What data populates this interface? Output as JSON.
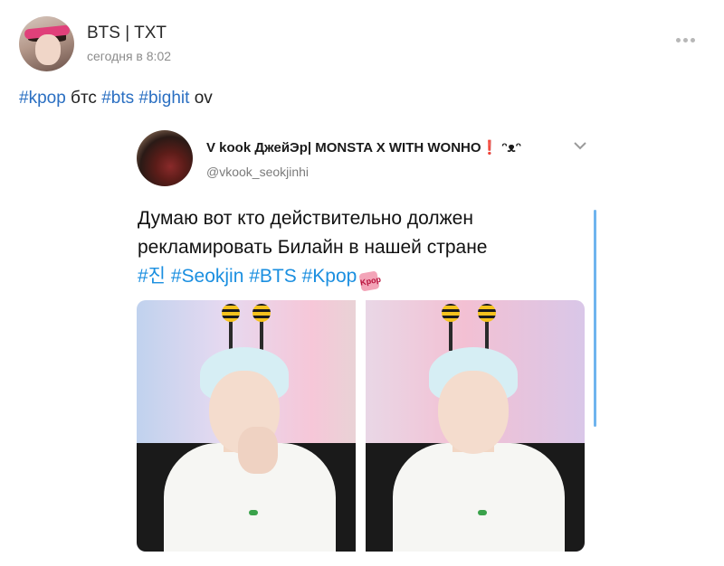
{
  "post": {
    "author": "BTS | TXT",
    "time": "сегодня в 8:02",
    "text_parts": [
      "#kpop",
      " бтс ",
      "#bts",
      " ",
      "#bighit",
      " ov"
    ]
  },
  "tweet": {
    "name": "V kook ДжейЭр| MONSTA X WITH WONHO❗ ᵔᴥᵔ",
    "handle": "@vkook_seokjinhi",
    "body_line1": "Думаю вот кто действительно должен",
    "body_line2": "рекламировать Билайн в нашей стране",
    "tags": "#진 #Seokjin #BTS #Kpop",
    "badge": "Kpop"
  },
  "icons": {
    "more": "more-dots-icon",
    "chevron": "chevron-down-icon"
  },
  "colors": {
    "hashtag_post": "#2a6fc2",
    "hashtag_tweet": "#1b8fe0",
    "scrollbar": "#6fb4ee"
  }
}
